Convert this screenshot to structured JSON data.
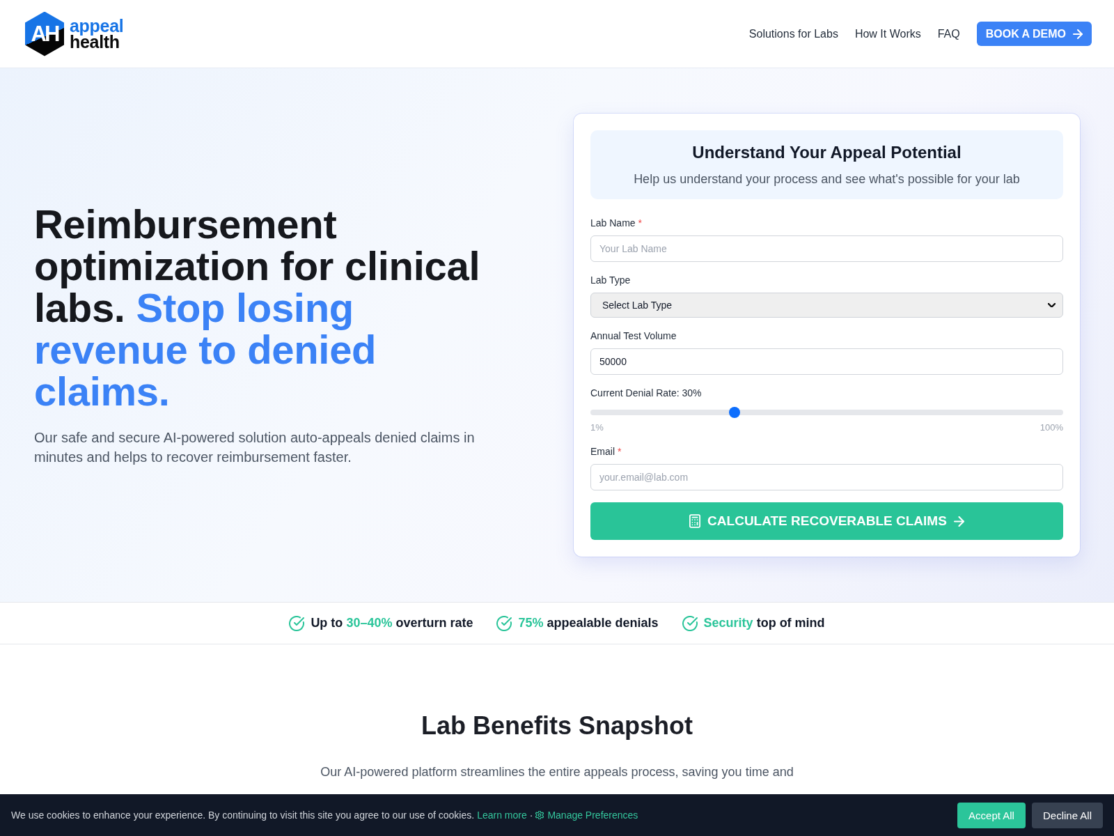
{
  "header": {
    "logo": {
      "monogram": "AH",
      "line1": "appeal",
      "line2": "health"
    },
    "nav": [
      {
        "label": "Solutions for Labs"
      },
      {
        "label": "How It Works"
      },
      {
        "label": "FAQ"
      }
    ],
    "cta": {
      "label": "BOOK A DEMO"
    }
  },
  "hero": {
    "heading": {
      "lead": "Reimbursement optimization for clinical labs.",
      "highlight": "Stop losing revenue to denied claims."
    },
    "description": "Our safe and secure AI-powered solution auto-appeals denied claims in minutes and helps to recover reimbursement faster."
  },
  "form": {
    "title": "Understand Your Appeal Potential",
    "subtitle": "Help us understand your process and see what's possible for your lab",
    "fields": [
      {
        "kind": "input",
        "label": "Lab Name",
        "required_mark": "*",
        "placeholder": "Your Lab Name"
      },
      {
        "kind": "select",
        "label": "Lab Type",
        "value": "Select Lab Type"
      },
      {
        "kind": "input",
        "label": "Annual Test Volume",
        "value": "50000"
      },
      {
        "kind": "slider",
        "label": "Current Denial Rate: 30%",
        "level": 0.3,
        "min_label": "1%",
        "max_label": "100%"
      },
      {
        "kind": "input",
        "label": "Email",
        "required_mark": "*",
        "placeholder": "your.email@lab.com"
      }
    ],
    "submit": {
      "label": "CALCULATE RECOVERABLE CLAIMS"
    }
  },
  "highlights": [
    {
      "before": "Up to ",
      "highlight": "30–40%",
      "after": " overturn rate"
    },
    {
      "highlight": "75%",
      "after": " appealable denials"
    },
    {
      "highlight": "Security",
      "after": " top of mind"
    }
  ],
  "benefits": {
    "title": "Lab Benefits Snapshot",
    "description": "Our AI-powered platform streamlines the entire appeals process, saving you time and"
  },
  "cookie_banner": {
    "message": "We use cookies to enhance your experience. By continuing to visit this site you agree to our use of cookies.",
    "learn_more": "Learn more",
    "separator": "·",
    "manage": "Manage Preferences",
    "buttons": [
      {
        "label": "Accept All",
        "kind": "primary"
      },
      {
        "label": "Decline All",
        "kind": "secondary"
      }
    ]
  }
}
